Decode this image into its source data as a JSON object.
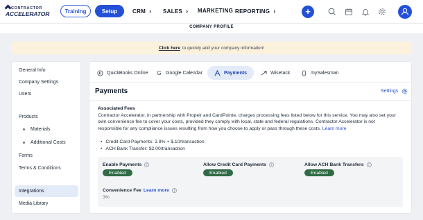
{
  "brand": {
    "line1": "CONTRACTOR",
    "line2": "ACCELERATOR"
  },
  "nav": {
    "training_label": "Training",
    "setup_label": "Setup",
    "menus": [
      "CRM",
      "SALES",
      "MARKETING",
      "REPORTING"
    ],
    "icons": [
      "plus-icon",
      "search-icon",
      "calendar-icon",
      "bell-icon",
      "gear-icon",
      "user-icon"
    ]
  },
  "subheader": {
    "title": "COMPANY PROFILE"
  },
  "banner": {
    "link": "Click here",
    "text": "to quickly add your company information!"
  },
  "sidebar": {
    "items": [
      {
        "label": "General Info"
      },
      {
        "label": "Company Settings"
      },
      {
        "label": "Users"
      },
      {
        "label": "Products"
      },
      {
        "label": "Materials"
      },
      {
        "label": "Additional Costs"
      },
      {
        "label": "Forms"
      },
      {
        "label": "Terms & Conditions"
      },
      {
        "label": "Integrations"
      },
      {
        "label": "Media Library"
      }
    ]
  },
  "tabs": [
    {
      "label": "QuickBooks Online",
      "icon": "quickbooks-icon"
    },
    {
      "label": "Google Calendar",
      "icon": "google-icon"
    },
    {
      "label": "Payments",
      "icon": "payments-icon"
    },
    {
      "label": "Wisetack",
      "icon": "wisetack-icon"
    },
    {
      "label": "mySalesman",
      "icon": "mysalesman-icon"
    }
  ],
  "panel": {
    "title": "Payments",
    "settings_label": "Settings",
    "fees_heading": "Associated Fees",
    "fees_description": "Contractor Accelerator, in partnership with Propelr and CardPointe, charges processing fees listed below for this service. You may also set your own convenience fee to cover your costs, provided they comply with local, state and federal regulations. Contractor Accelerator is not responsible for any compliance issues resulting from how you choose to apply or pass through these costs.",
    "learn_more": "Learn more",
    "fees": [
      "Credit Card Payments: 2.8% + $.10/transaction",
      "ACH Bank Transfer: $2.00/transaction"
    ],
    "options": [
      {
        "label": "Enable Payments",
        "status": "Enabled"
      },
      {
        "label": "Allow Credit Card Payments",
        "status": "Enabled"
      },
      {
        "label": "Allow ACH Bank Transfers",
        "status": "Enabled"
      }
    ],
    "convenience_fee_label": "Convenience Fee",
    "convenience_fee_learn_more": "Learn more",
    "convenience_fee_value": "3%"
  },
  "colors": {
    "accent": "#2350d6",
    "enabled_badge": "#2f6b45",
    "banner_bg": "#fcf1dd",
    "active_bg": "#e3ebf9"
  }
}
